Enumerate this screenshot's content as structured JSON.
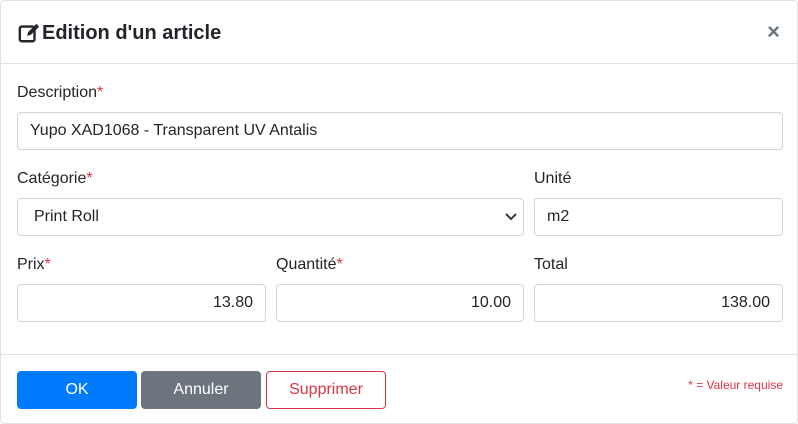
{
  "dialog": {
    "title": "Edition d'un article",
    "close_label": "×"
  },
  "fields": {
    "description": {
      "label": "Description",
      "required_mark": "*",
      "value": "Yupo XAD1068 - Transparent UV Antalis"
    },
    "categorie": {
      "label": "Catégorie",
      "required_mark": "*",
      "value": "Print Roll"
    },
    "unite": {
      "label": "Unité",
      "value": "m2"
    },
    "prix": {
      "label": "Prix",
      "required_mark": "*",
      "value": "13.80"
    },
    "quantite": {
      "label": "Quantité",
      "required_mark": "*",
      "value": "10.00"
    },
    "total": {
      "label": "Total",
      "value": "138.00"
    }
  },
  "footer": {
    "ok_label": "OK",
    "cancel_label": "Annuler",
    "delete_label": "Supprimer",
    "required_note": "* = Valeur requise"
  },
  "colors": {
    "primary": "#007bff",
    "secondary": "#6c757d",
    "danger": "#dc3545"
  },
  "icons": {
    "title": "edit-icon",
    "close": "close-icon",
    "select": "chevron-down-icon"
  }
}
